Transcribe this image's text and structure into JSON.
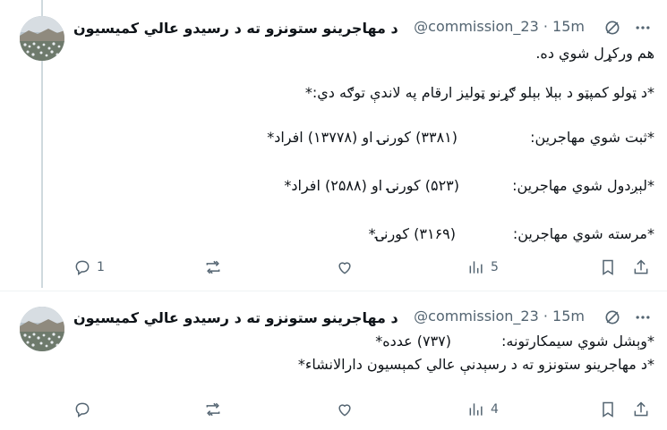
{
  "tweets": [
    {
      "name": "د مهاجرینو ستونزو ته د رسیدو عالي کمیسیون",
      "handle": "@commission_23",
      "sep": "·",
      "time": "15m",
      "lines": {
        "l1": "هم ورکړل شوي ده.",
        "l2": "*د ټولو کمپټو د بېلا بېلو ګړنو ټولیز ارقام په لاندې توګه دي:*",
        "r1_label": "*ثبت شوي مهاجرین:",
        "r1_value": "(۳۳۸۱) کورنۍ او (۱۳۷۷۸) افراد*",
        "r2_label": "*لېږدول شوي مهاجرین:",
        "r2_value": "(۵۲۳) کورنۍ او (۲۵۸۸) افراد*",
        "r3_label": "*مرسته شوي مهاجرین:",
        "r3_value": "(۳۱۶۹) کورنۍ*"
      },
      "stats": {
        "replies": "1",
        "reposts": "",
        "likes": "",
        "views": "5"
      }
    },
    {
      "name": "د مهاجرینو ستونزو ته د رسیدو عالي کمیسیون",
      "handle": "@commission_23",
      "sep": "·",
      "time": "15m",
      "lines": {
        "r1_label": "*وېشل شوي سیمکارتونه:",
        "r1_value": "(۷۳۷) عدده*",
        "l2": "*د مهاجرینو ستونزو ته د رسېدنې عالي کمېسیون دارالانشاء*"
      },
      "stats": {
        "replies": "",
        "reposts": "",
        "likes": "",
        "views": "4"
      }
    }
  ],
  "icons": {
    "grok": "grok-icon",
    "more": "more-icon",
    "reply": "reply-icon",
    "repost": "repost-icon",
    "like": "like-icon",
    "views": "views-icon",
    "bookmark": "bookmark-icon",
    "share": "share-icon"
  },
  "colors": {
    "muted": "#536471",
    "text": "#0f1419",
    "thread": "#cfd9de"
  }
}
